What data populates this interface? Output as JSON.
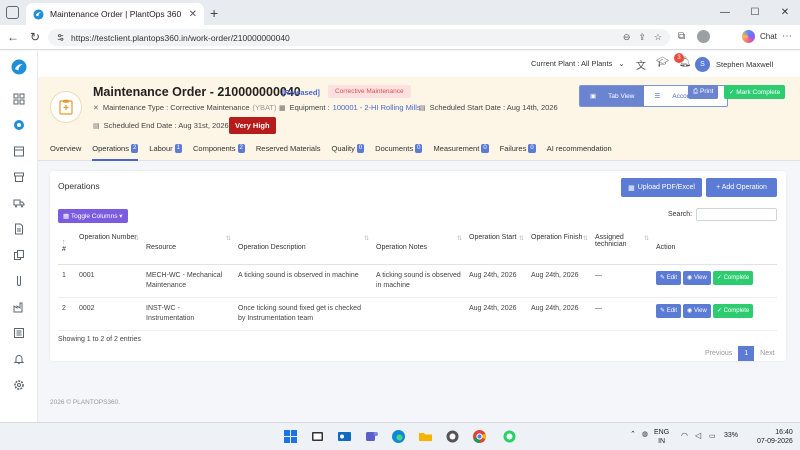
{
  "browser": {
    "tab_title": "Maintenance Order | PlantOps 360",
    "url": "https://testclient.plantops360.in/work-order/210000000040",
    "copilot_label": "Chat"
  },
  "app": {
    "plant_selector": "Current Plant : All Plants",
    "notification_count": "3",
    "user_initial": "S",
    "user_name": "Stephen Maxwell"
  },
  "order": {
    "title": "Maintenance Order - 210000000040",
    "status": "[Released]",
    "type_badge": "Corrective Maintenance",
    "maintenance_type_label": "Maintenance Type : Corrective Maintenance",
    "maintenance_type_code": "(YBAT)",
    "equipment_label": "Equipment :",
    "equipment_value": "100001 - 2-HI Rolling Mills",
    "start_date": "Scheduled Start Date : Aug 14th, 2026",
    "end_date": "Scheduled End Date : Aug 31st, 2026",
    "priority": "Very High",
    "tab_view": "Tab View",
    "accordion_view": "Accordion View",
    "print": "Print",
    "mark_complete": "Mark Complete"
  },
  "tabs": [
    {
      "label": "Overview",
      "badge": ""
    },
    {
      "label": "Operations",
      "badge": "2"
    },
    {
      "label": "Labour",
      "badge": "1"
    },
    {
      "label": "Components",
      "badge": "2"
    },
    {
      "label": "Reserved Materials",
      "badge": ""
    },
    {
      "label": "Quality",
      "badge": "0"
    },
    {
      "label": "Documents",
      "badge": "0"
    },
    {
      "label": "Measurement",
      "badge": "0"
    },
    {
      "label": "Failures",
      "badge": "0"
    },
    {
      "label": "AI recommendation",
      "badge": ""
    }
  ],
  "operations": {
    "title": "Operations",
    "upload_btn": "Upload PDF/Excel",
    "add_btn": "+ Add Operation",
    "toggle_columns": "Toggle Columns",
    "search_label": "Search:",
    "search_value": "",
    "columns": [
      "#",
      "Operation Number",
      "Resource",
      "Operation Description",
      "Operation Notes",
      "Operation Start",
      "Operation Finish",
      "Assigned technician",
      "Action"
    ],
    "rows": [
      {
        "idx": "1",
        "number": "0001",
        "resource": "MECH-WC - Mechanical Maintenance",
        "description": "A ticking sound is observed in machine",
        "notes": "A ticking sound is observed in machine",
        "start": "Aug 24th, 2026",
        "finish": "Aug 24th, 2026",
        "technician": "—"
      },
      {
        "idx": "2",
        "number": "0002",
        "resource": "INST-WC - Instrumentation",
        "description": "Once ticking sound fixed get is checked by Instrumentation team",
        "notes": "",
        "start": "Aug 24th, 2026",
        "finish": "Aug 24th, 2026",
        "technician": "—"
      }
    ],
    "action_edit": "Edit",
    "action_view": "View",
    "action_complete": "Complete",
    "showing": "Showing 1 to 2 of 2 entries",
    "pager_prev": "Previous",
    "pager_current": "1",
    "pager_next": "Next"
  },
  "footer": "2026 © PLANTOPS360.",
  "taskbar": {
    "lang_line1": "ENG",
    "lang_line2": "IN",
    "battery": "33%",
    "time": "16:40",
    "date": "07-09-2026"
  },
  "colors": {
    "accent": "#5b7bd5",
    "success": "#2ecc71",
    "danger": "#b71c1c",
    "header_bg": "#fdf5e6"
  }
}
